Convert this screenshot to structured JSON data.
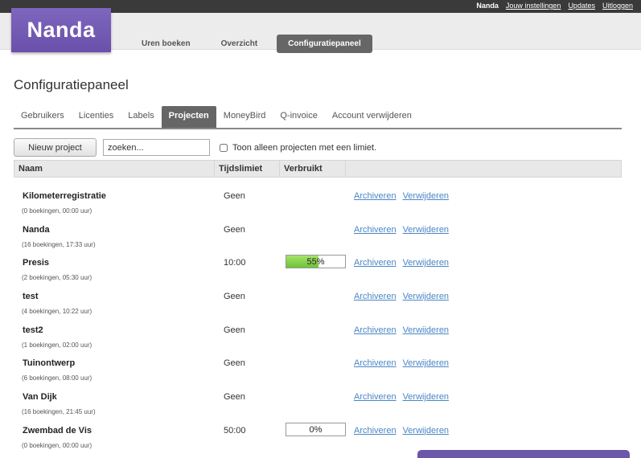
{
  "topbar": {
    "username": "Nanda",
    "links": [
      "Jouw instellingen",
      "Updates",
      "Uitloggen"
    ]
  },
  "brand": {
    "logo_text": "Nanda",
    "color": "#7459b4"
  },
  "nav": {
    "items": [
      {
        "label": "Uren boeken",
        "active": false
      },
      {
        "label": "Overzicht",
        "active": false
      },
      {
        "label": "Configuratiepaneel",
        "active": true
      }
    ]
  },
  "page": {
    "title": "Configuratiepaneel"
  },
  "tabs": [
    {
      "label": "Gebruikers",
      "active": false
    },
    {
      "label": "Licenties",
      "active": false
    },
    {
      "label": "Labels",
      "active": false
    },
    {
      "label": "Projecten",
      "active": true
    },
    {
      "label": "MoneyBird",
      "active": false
    },
    {
      "label": "Q-invoice",
      "active": false
    },
    {
      "label": "Account verwijderen",
      "active": false
    }
  ],
  "toolbar": {
    "new_label": "Nieuw project",
    "search_placeholder": "zoeken...",
    "filter_label": "Toon alleen projecten met een limiet.",
    "filter_checked": false
  },
  "table": {
    "headers": [
      "Naam",
      "Tijdslimiet",
      "Verbruikt",
      ""
    ],
    "rows": [
      {
        "name": "Kilometerregistratie",
        "meta": "(0 boekingen, 00:00 uur)",
        "limit": "Geen",
        "used": null
      },
      {
        "name": "Nanda",
        "meta": "(16 boekingen, 17:33 uur)",
        "limit": "Geen",
        "used": null
      },
      {
        "name": "Presis",
        "meta": "(2 boekingen, 05:30 uur)",
        "limit": "10:00",
        "used": 55,
        "used_label": "55%"
      },
      {
        "name": "test",
        "meta": "(4 boekingen, 10:22 uur)",
        "limit": "Geen",
        "used": null
      },
      {
        "name": "test2",
        "meta": "(1 boekingen, 02:00 uur)",
        "limit": "Geen",
        "used": null
      },
      {
        "name": "Tuinontwerp",
        "meta": "(6 boekingen, 08:00 uur)",
        "limit": "Geen",
        "used": null
      },
      {
        "name": "Van Dijk",
        "meta": "(16 boekingen, 21:45 uur)",
        "limit": "Geen",
        "used": null
      },
      {
        "name": "Zwembad de Vis",
        "meta": "(0 boekingen, 00:00 uur)",
        "limit": "50:00",
        "used": 0,
        "used_label": "0%"
      }
    ],
    "action_archive": "Archiveren",
    "action_delete": "Verwijderen"
  }
}
